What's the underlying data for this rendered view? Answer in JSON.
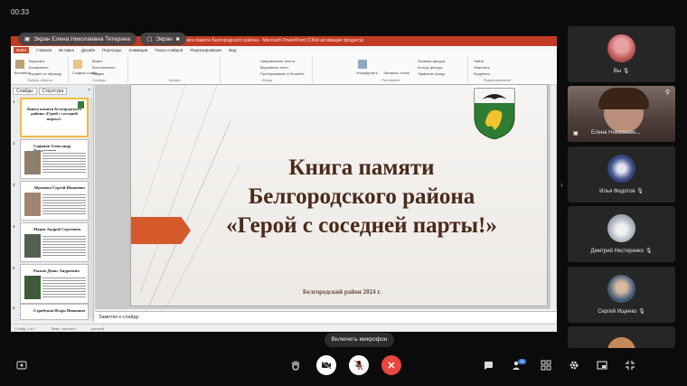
{
  "meeting": {
    "timer": "00:33",
    "presenter_pill": "Экран Елена Николаевна Тетерина",
    "screen_pill": "Экран"
  },
  "app": {
    "window_title": "Книга памяти Белгородского района - Microsoft PowerPoint (Сбой активации продукта)",
    "ribbon_tabs": [
      "Файл",
      "Главная",
      "Вставка",
      "Дизайн",
      "Переходы",
      "Анимация",
      "Показ слайдов",
      "Рецензирование",
      "Вид"
    ],
    "ribbon_buttons": {
      "paste": "Вставить",
      "cut": "Вырезать",
      "copy": "Копировать",
      "format_painter": "Формат по образцу",
      "new_slide": "Создать слайд",
      "layout": "Макет",
      "reset": "Восстановить",
      "section": "Раздел",
      "arrange": "Упорядочить",
      "quick_styles": "Экспресс-стили",
      "shape_fill": "Заливка фигуры",
      "shape_outline": "Контур фигуры",
      "shape_effects": "Эффекты фигур",
      "find": "Найти",
      "replace": "Заменить",
      "select": "Выделить",
      "text_direction": "Направление текста",
      "align_text": "Выровнять текст",
      "smartart": "Преобразовать в SmartArt"
    },
    "ribbon_groups": [
      "Буфер обмена",
      "Слайды",
      "Шрифт",
      "Абзац",
      "Рисование",
      "Редактирование"
    ],
    "pane_tabs": [
      "Слайды",
      "Структура"
    ],
    "slide": {
      "title": "Книга памяти Белгородского района «Герой с соседней парты!»",
      "title_lines": [
        "Книга памяти",
        "Белгородского района",
        "«Герой с соседней парты!»"
      ],
      "footer": "Белгородский район 2024 г."
    },
    "thumbnails": [
      {
        "num": "1",
        "text": "Книга памяти Белгородского района «Герой с соседней парты!»"
      },
      {
        "num": "2",
        "text": "Сафонов Александр Николаевич"
      },
      {
        "num": "3",
        "text": "Абрамова Сергей Иванович"
      },
      {
        "num": "4",
        "text": "Мацев Андрей Сергеевич"
      },
      {
        "num": "5",
        "text": "Рыжов Денис Андреевич"
      },
      {
        "num": "6",
        "text": "Стрибунов Игорь Иванович"
      }
    ],
    "notes_placeholder": "Заметки к слайду",
    "status": [
      "Слайд 1 из 7",
      "Тема: «Аспект»",
      "русский"
    ]
  },
  "participants": [
    {
      "name": "Вы",
      "type": "avatar"
    },
    {
      "name": "Елена Николаевн...",
      "type": "video"
    },
    {
      "name": "Илья Федотов",
      "type": "avatar"
    },
    {
      "name": "Дмитрий Нестеренко",
      "type": "avatar"
    },
    {
      "name": "Сергей Ищенко",
      "type": "avatar"
    }
  ],
  "controls": {
    "tooltip": "Включить микрофон",
    "participants_count": "16"
  },
  "colors": {
    "accent_red": "#e8473f",
    "slide_arrow": "#d55a2b",
    "slide_title": "#4a2a1a"
  }
}
